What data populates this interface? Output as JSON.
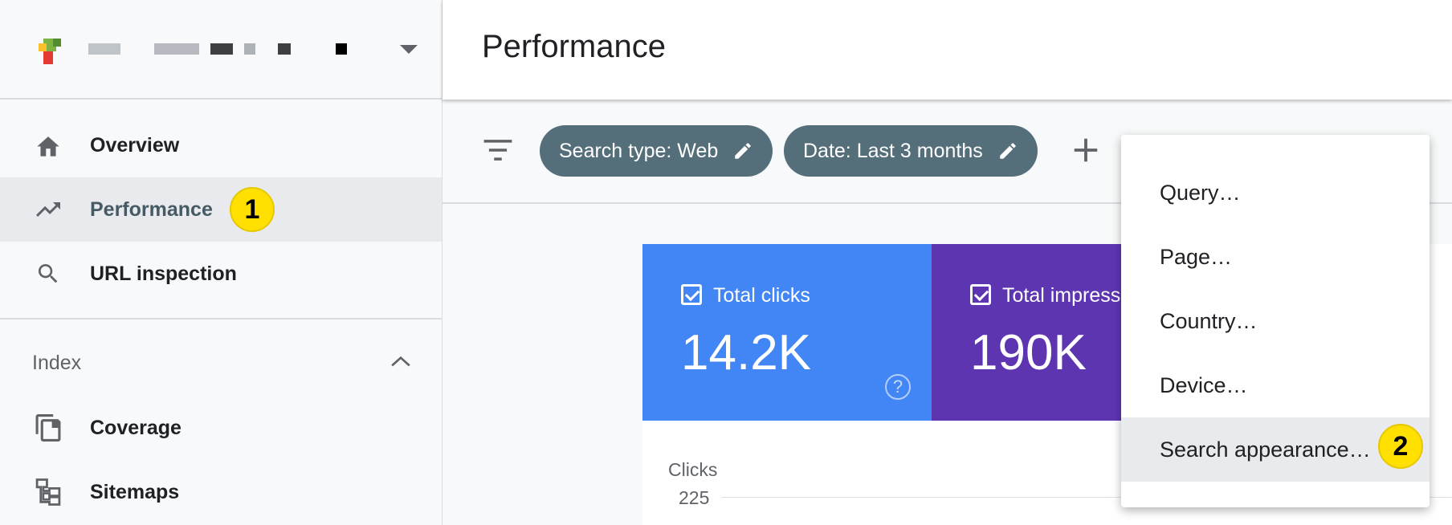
{
  "sidebar": {
    "items": [
      {
        "label": "Overview",
        "icon": "home-icon"
      },
      {
        "label": "Performance",
        "icon": "trending-up-icon",
        "active": true
      },
      {
        "label": "URL inspection",
        "icon": "search-icon"
      }
    ],
    "index_section": {
      "label": "Index",
      "items": [
        {
          "label": "Coverage",
          "icon": "coverage-icon"
        },
        {
          "label": "Sitemaps",
          "icon": "sitemap-icon"
        }
      ]
    }
  },
  "header": {
    "title": "Performance"
  },
  "filters": {
    "chips": [
      {
        "label": "Search type: Web"
      },
      {
        "label": "Date: Last 3 months"
      }
    ]
  },
  "cards": [
    {
      "label": "Total clicks",
      "value": "14.2K",
      "color": "#4285f4"
    },
    {
      "label": "Total impress",
      "value": "190K",
      "color": "#5e35b1"
    }
  ],
  "chart": {
    "ylabel": "Clicks",
    "tick": "225"
  },
  "menu": {
    "items": [
      "Query…",
      "Page…",
      "Country…",
      "Device…",
      "Search appearance…"
    ]
  },
  "annotations": {
    "badge1": "1",
    "badge2": "2"
  },
  "colors": {
    "chip": "#546e7a",
    "accent_badge": "#ffe000"
  }
}
